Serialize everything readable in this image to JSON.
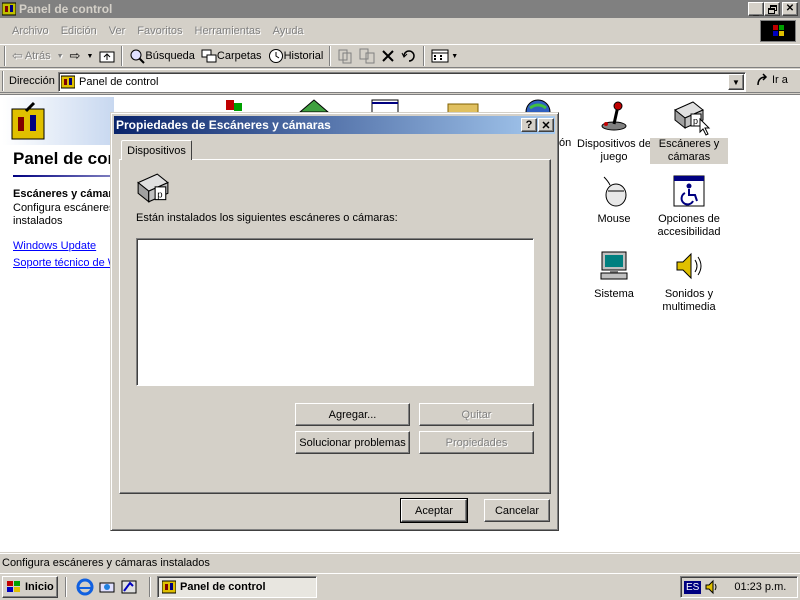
{
  "window": {
    "title": "Panel de control",
    "controls": {
      "minimize": "_",
      "maximize": "▫",
      "close": "✕"
    }
  },
  "menu": [
    "Archivo",
    "Edición",
    "Ver",
    "Favoritos",
    "Herramientas",
    "Ayuda"
  ],
  "toolbar": {
    "back": "Atrás",
    "search": "Búsqueda",
    "folders": "Carpetas",
    "history": "Historial"
  },
  "address": {
    "label": "Dirección",
    "value": "Panel de control",
    "go": "Ir a"
  },
  "leftpane": {
    "title": "Panel de control",
    "item_title": "Escáneres y cámaras",
    "item_desc_1": "Configura escáneres y cámaras",
    "item_desc_2": "instalados",
    "link_update": "Windows Update",
    "link_support": "Soporte técnico de Windows"
  },
  "partial_label": "ón",
  "items": [
    {
      "label_1": "Dispositivos de",
      "label_2": "juego",
      "icon": "joystick-icon"
    },
    {
      "label_1": "Escáneres y",
      "label_2": "cámaras",
      "icon": "scanner-icon",
      "selected": true
    },
    {
      "label_1": "Mouse",
      "label_2": "",
      "icon": "mouse-icon"
    },
    {
      "label_1": "Opciones de",
      "label_2": "accesibilidad",
      "icon": "accessibility-icon"
    },
    {
      "label_1": "Sistema",
      "label_2": "",
      "icon": "computer-icon"
    },
    {
      "label_1": "Sonidos y",
      "label_2": "multimedia",
      "icon": "speaker-icon"
    }
  ],
  "statusbar": "Configura escáneres y cámaras instalados",
  "dialog": {
    "title": "Propiedades de Escáneres y cámaras",
    "help": "?",
    "close": "✕",
    "tab": "Dispositivos",
    "description": "Están instalados los siguientes escáneres o cámaras:",
    "buttons": {
      "add": "Agregar...",
      "remove": "Quitar",
      "troubleshoot": "Solucionar problemas",
      "properties": "Propiedades",
      "ok": "Aceptar",
      "cancel": "Cancelar"
    }
  },
  "taskbar": {
    "start": "Inicio",
    "task": "Panel de control",
    "lang": "ES",
    "clock": "01:23 p.m."
  },
  "colors": {
    "dialog_title_start": "#0a246a",
    "dialog_title_end": "#a6caf0",
    "inactive_title": "#808080",
    "face": "#d4d0c8"
  }
}
